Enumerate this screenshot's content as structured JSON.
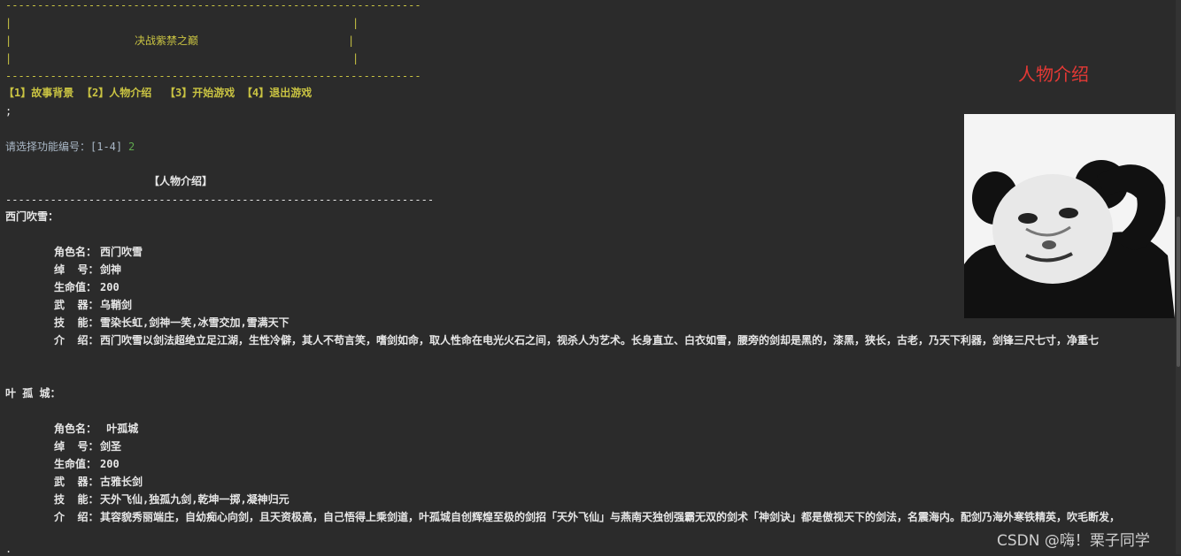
{
  "banner": {
    "border_top": "-----------------------------------------------------------------",
    "pipe_left": "|",
    "pipe_right": "|",
    "title": "决战紫禁之巅",
    "border_bottom": "-----------------------------------------------------------------"
  },
  "menu": {
    "item1": "【1】故事背景",
    "item2": "【2】人物介绍",
    "item3": "【3】开始游戏",
    "item4": "【4】退出游戏"
  },
  "semicolon": ";",
  "prompt": {
    "label": "请选择功能编号：[1-4]",
    "value": "2"
  },
  "section": {
    "heading": "【人物介绍】",
    "divider": "-------------------------------------------------------------------"
  },
  "characters": [
    {
      "header": "西门吹雪：",
      "rows": [
        {
          "label": "角色名：",
          "value": "西门吹雪"
        },
        {
          "label": "绰  号：",
          "value": "剑神"
        },
        {
          "label": "生命值：",
          "value": "200"
        },
        {
          "label": "武  器：",
          "value": "乌鞘剑"
        },
        {
          "label": "技  能：",
          "value": "雪染长虹,剑神一笑,冰雪交加,雪满天下"
        },
        {
          "label": "介  绍：",
          "value": "西门吹雪以剑法超绝立足江湖，生性冷僻，其人不苟言笑，嗜剑如命，取人性命在电光火石之间，视杀人为艺术。长身直立、白衣如雪，腰旁的剑却是黑的，漆黑，狭长，古老，乃天下利器，剑锋三尺七寸，净重七"
        }
      ]
    },
    {
      "header": "叶 孤 城：",
      "rows": [
        {
          "label": "角色名：",
          "value": " 叶孤城"
        },
        {
          "label": "绰  号：",
          "value": "剑圣"
        },
        {
          "label": "生命值：",
          "value": "200"
        },
        {
          "label": "武  器：",
          "value": "古雅长剑"
        },
        {
          "label": "技  能：",
          "value": "天外飞仙,独孤九剑,乾坤一掷,凝神归元"
        },
        {
          "label": "介  绍：",
          "value": "其容貌秀丽端庄，自幼痴心向剑，且天资极高，自己悟得上乘剑道，叶孤城自创辉煌至极的剑招「天外飞仙」与燕南天独创强霸无双的剑术「神剑诀」都是傲视天下的剑法，名震海内。配剑乃海外寒铁精英，吹毛断发，"
        }
      ]
    }
  ],
  "side_title": "人物介绍",
  "watermark": "CSDN @嗨！栗子同学",
  "bottom_fragment": "."
}
